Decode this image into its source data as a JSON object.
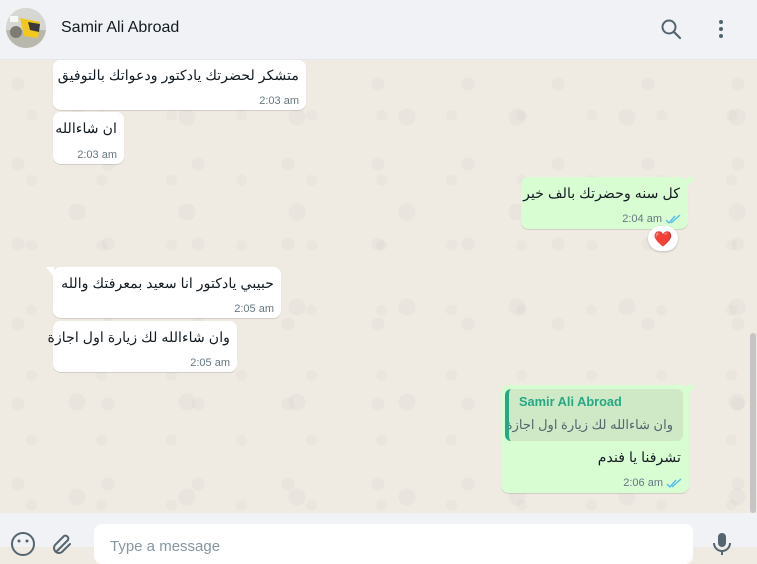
{
  "header": {
    "contact_name": "Samir Ali Abroad",
    "icons": [
      "search-icon",
      "menu-icon"
    ]
  },
  "messages": [
    {
      "direction": "incoming",
      "text": "متشكر لحضرتك يادكتور ودعواتك بالتوفيق",
      "time": "2:03 am"
    },
    {
      "direction": "incoming",
      "text": "ان شاءالله",
      "time": "2:03 am"
    },
    {
      "direction": "outgoing",
      "text": "كل سنه وحضرتك بالف خير",
      "time": "2:04 am",
      "status": "read",
      "reaction": "❤️"
    },
    {
      "direction": "incoming",
      "text": "حبيبي يادكتور انا سعيد بمعرفتك والله",
      "time": "2:05 am"
    },
    {
      "direction": "incoming",
      "text": "وان شاءالله لك زيارة اول اجازة",
      "time": "2:05 am"
    },
    {
      "direction": "outgoing",
      "quoted_author": "Samir Ali Abroad",
      "quoted_text": "وان شاءالله لك زيارة اول اجازة",
      "text": "تشرفنا يا فندم",
      "time": "2:06 am",
      "status": "read"
    }
  ],
  "composer": {
    "placeholder": "Type a message",
    "icons": [
      "emoji-icon",
      "attach-icon",
      "microphone-icon"
    ]
  },
  "colors": {
    "incoming_bubble": "#ffffff",
    "outgoing_bubble": "#d9fdd3",
    "chat_background": "#efeae2",
    "read_tick": "#53bdeb",
    "quote_accent": "#25a884"
  }
}
